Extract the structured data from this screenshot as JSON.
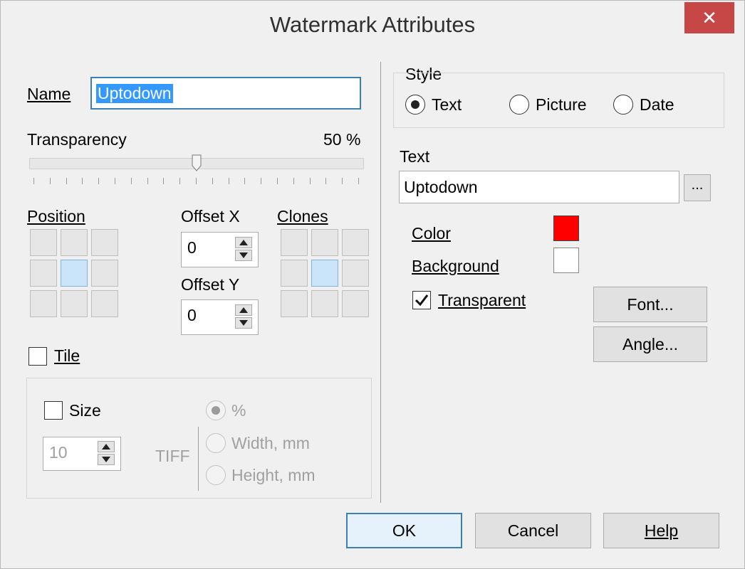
{
  "window": {
    "title": "Watermark Attributes",
    "close_label": "✕"
  },
  "name_field": {
    "label": "Name",
    "value": "Uptodown"
  },
  "transparency": {
    "label": "Transparency",
    "value_text": "50 %",
    "value": 50
  },
  "position": {
    "label": "Position"
  },
  "offset_x": {
    "label": "Offset X",
    "value": "0"
  },
  "offset_y": {
    "label": "Offset Y",
    "value": "0"
  },
  "clones": {
    "label": "Clones"
  },
  "tile": {
    "label": "Tile",
    "checked": false
  },
  "size": {
    "label": "Size",
    "checked": false,
    "value": "10",
    "format_label": "TIFF",
    "unit_options": [
      "%",
      "Width, mm",
      "Height, mm"
    ]
  },
  "style": {
    "label": "Style",
    "options": [
      "Text",
      "Picture",
      "Date"
    ],
    "selected": "Text"
  },
  "text_field": {
    "label": "Text",
    "value": "Uptodown",
    "browse_label": "..."
  },
  "color": {
    "label": "Color",
    "value": "#ff0000"
  },
  "background": {
    "label": "Background",
    "value": "#ffffff"
  },
  "transparent": {
    "label": "Transparent",
    "checked": true
  },
  "buttons": {
    "font": "Font...",
    "angle": "Angle...",
    "ok": "OK",
    "cancel": "Cancel",
    "help": "Help"
  }
}
